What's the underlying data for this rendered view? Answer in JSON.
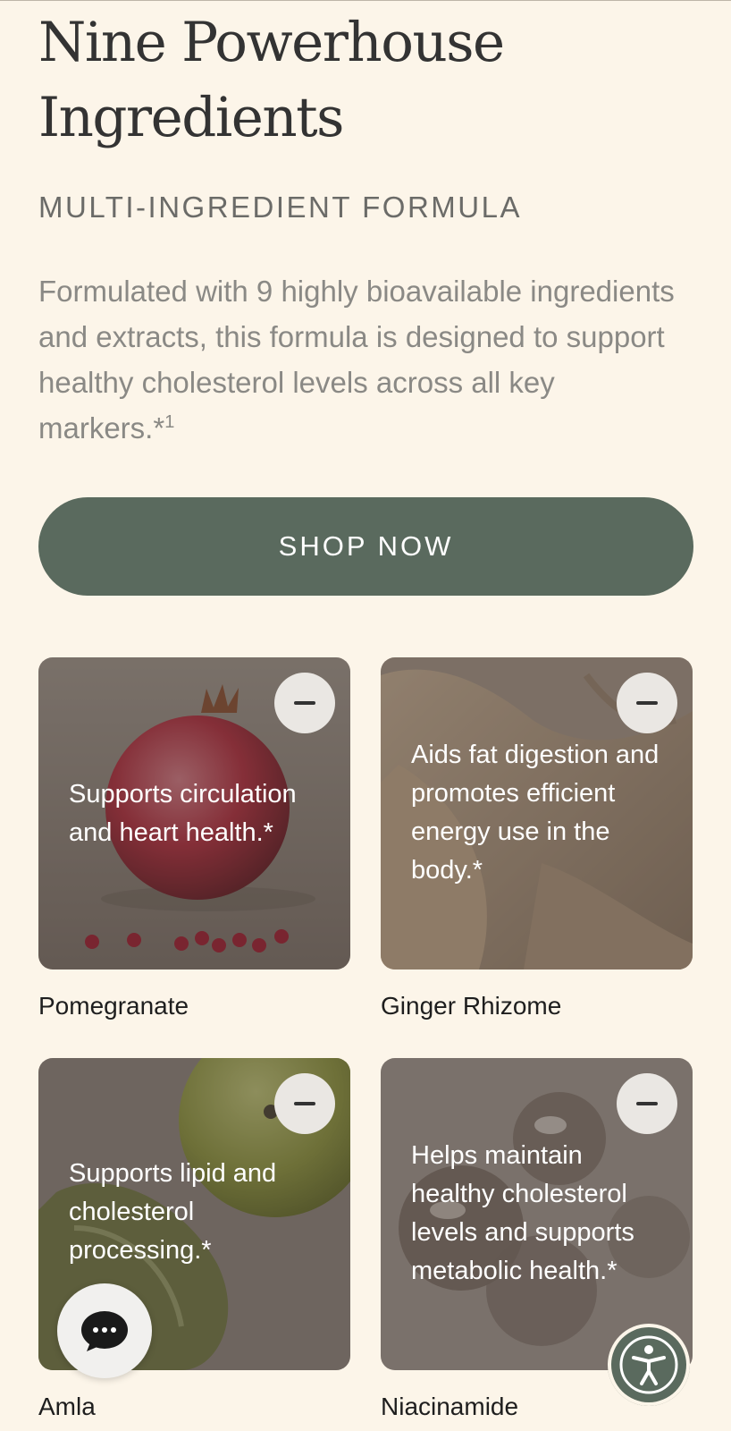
{
  "section": {
    "title_line1": "Nine Powerhouse",
    "title_line2": "Ingredients",
    "eyebrow": "MULTI-INGREDIENT FORMULA",
    "description": "Formulated with 9 highly bioavailable ingredients and extracts, this formula is designed to support healthy cholesterol levels across all key markers.*",
    "description_footnote": "1",
    "cta_label": "SHOP NOW"
  },
  "ingredients": [
    {
      "name": "Pomegranate",
      "benefit": "Supports circulation and heart health.*",
      "toggle_icon": "minus-icon"
    },
    {
      "name": "Ginger Rhizome",
      "benefit": "Aids fat digestion and promotes efficient energy use in the body.*",
      "toggle_icon": "minus-icon"
    },
    {
      "name": "Amla",
      "benefit": "Supports lipid and cholesterol processing.*",
      "toggle_icon": "minus-icon"
    },
    {
      "name": "Niacinamide",
      "benefit": "Helps maintain healthy cholesterol levels and supports metabolic health.*",
      "toggle_icon": "minus-icon"
    }
  ],
  "widgets": {
    "chat_icon": "chat-bubble-icon",
    "accessibility_icon": "accessibility-icon"
  },
  "colors": {
    "background": "#fcf5e9",
    "cta_background": "#5a6a5e",
    "cta_text": "#ffffff"
  }
}
